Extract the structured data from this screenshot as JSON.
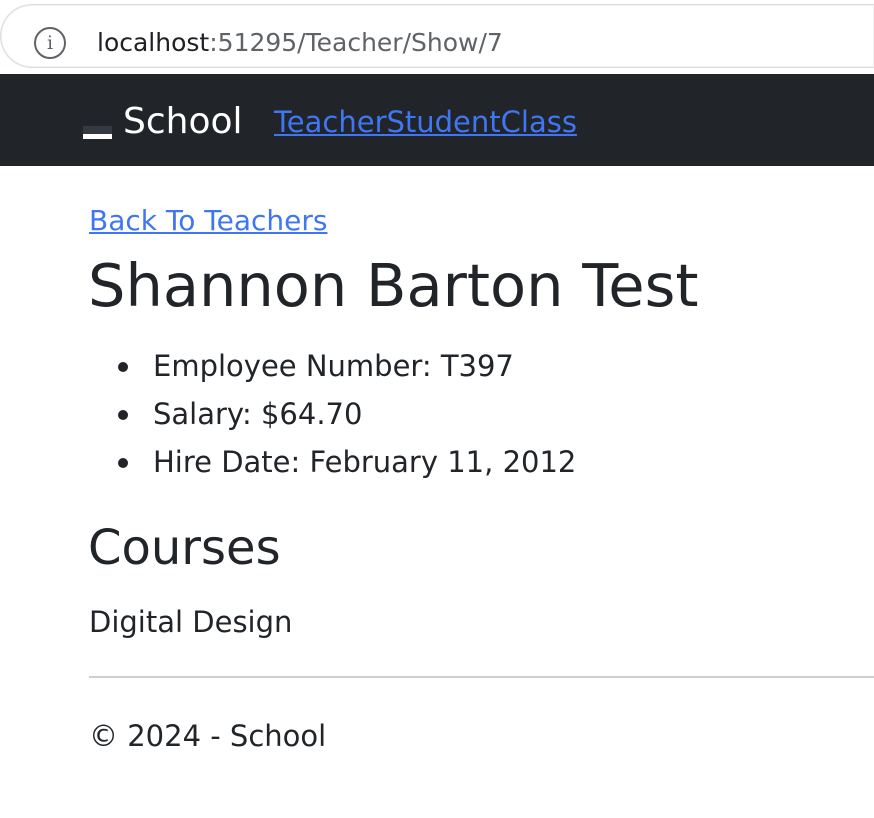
{
  "browser": {
    "url_host": "localhost",
    "url_rest": ":51295/Teacher/Show/7",
    "info_icon": "info-icon"
  },
  "navbar": {
    "brand": "School",
    "links": [
      "TeacherStudentClass"
    ],
    "background_color": "#212529",
    "link_color": "#3f76f4"
  },
  "main": {
    "back_link": "Back To Teachers",
    "teacher_name": "Shannon Barton Test",
    "details": [
      "Employee Number: T397",
      "Salary: $64.70",
      "Hire Date: February 11, 2012"
    ],
    "courses_heading": "Courses",
    "courses": [
      "Digital Design"
    ]
  },
  "footer": {
    "text": "© 2024 - School"
  }
}
